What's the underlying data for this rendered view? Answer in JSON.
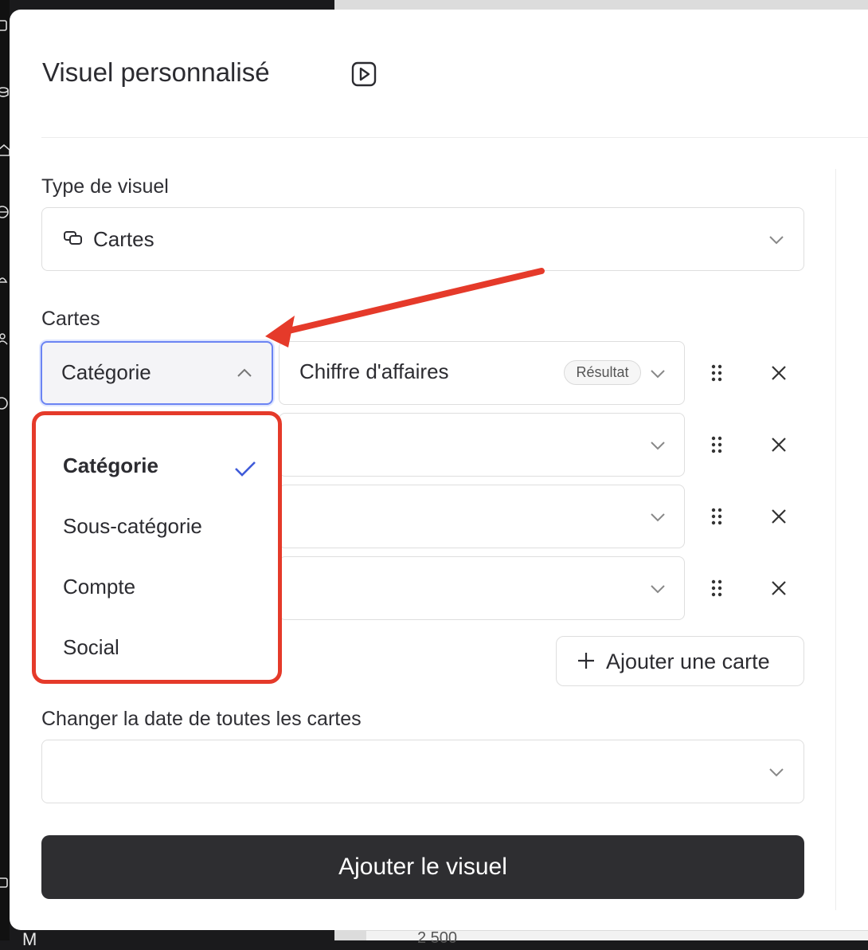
{
  "modal": {
    "title": "Visuel personnalisé",
    "play_icon": "play-square-icon"
  },
  "visual_type": {
    "label": "Type de visuel",
    "value": "Cartes",
    "icon": "cards-icon"
  },
  "cards": {
    "label": "Cartes",
    "rows": [
      {
        "dimension": "Catégorie",
        "metric": "Chiffre d'affaires",
        "badge": "Résultat"
      },
      {
        "dimension": "",
        "metric": "",
        "badge": ""
      },
      {
        "dimension": "",
        "metric": "",
        "badge": ""
      },
      {
        "dimension": "",
        "metric": "",
        "badge": ""
      }
    ],
    "add_label": "Ajouter une carte"
  },
  "dropdown": {
    "options": [
      "Catégorie",
      "Sous-catégorie",
      "Compte",
      "Social"
    ],
    "selected": "Catégorie"
  },
  "date_change": {
    "label": "Changer la date de toutes les cartes",
    "value": ""
  },
  "submit_label": "Ajouter le visuel",
  "background": {
    "bottom_text": "M",
    "bottom_number": "2 500"
  },
  "colors": {
    "accent_focus": "#6b84f3",
    "highlight_red": "#e53a2a",
    "check_blue": "#3f5bd9",
    "primary_button": "#2e2e31"
  }
}
